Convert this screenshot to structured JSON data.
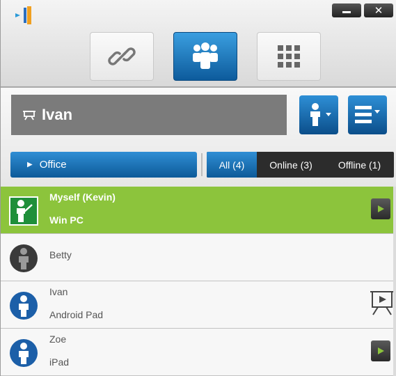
{
  "window": {
    "minimize_label": "–",
    "close_label": "×"
  },
  "modes": [
    {
      "icon": "link-icon",
      "active": false
    },
    {
      "icon": "group-icon",
      "active": true
    },
    {
      "icon": "grid-icon",
      "active": false
    }
  ],
  "header": {
    "name": "Ivan"
  },
  "group": {
    "label": "Office"
  },
  "filters": [
    {
      "label": "All (4)",
      "active": true
    },
    {
      "label": "Online (3)",
      "active": false
    },
    {
      "label": "Offline (1)",
      "active": false
    }
  ],
  "contacts": [
    {
      "line1": "Myself (Kevin)",
      "line2": "Win PC",
      "highlighted": true,
      "action": "play-icon"
    },
    {
      "line1": "Betty",
      "line2": "",
      "highlighted": false,
      "action": ""
    },
    {
      "line1": "Ivan",
      "line2": "Android Pad",
      "highlighted": false,
      "action": "presentation-icon"
    },
    {
      "line1": "Zoe",
      "line2": "iPad",
      "highlighted": false,
      "action": "play-icon"
    }
  ],
  "colors": {
    "accent_blue": "#1a6fb5",
    "self_green": "#8cc43c",
    "offline_gray": "#3a3a3a"
  }
}
